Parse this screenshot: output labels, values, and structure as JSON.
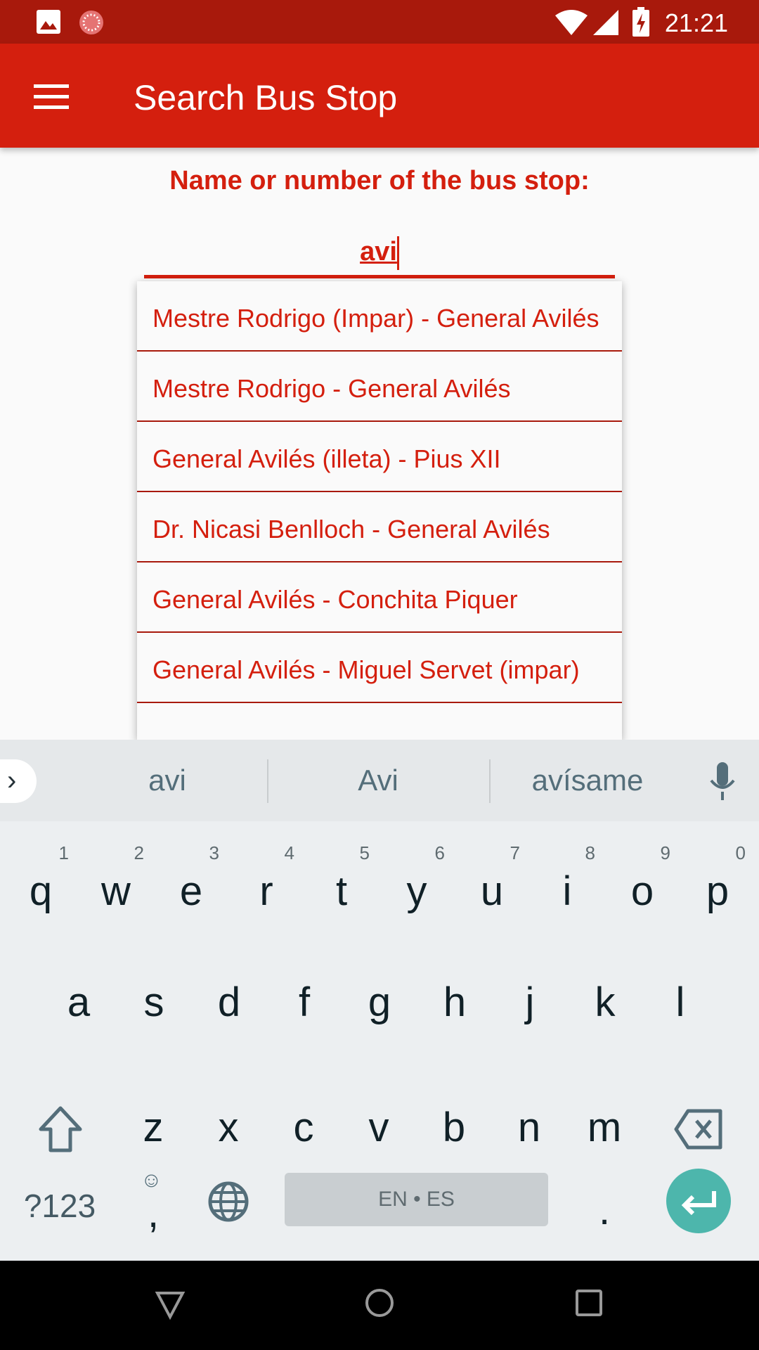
{
  "status": {
    "time": "21:21"
  },
  "appbar": {
    "title": "Search Bus Stop"
  },
  "search": {
    "label": "Name or number of the bus stop:",
    "value": "avi"
  },
  "suggestions": [
    "Mestre Rodrigo (Impar) - General Avilés",
    "Mestre Rodrigo - General Avilés",
    "General Avilés (illeta) - Pius XII",
    "Dr. Nicasi Benlloch - General Avilés",
    "General Avilés - Conchita Piquer",
    "General Avilés - Miguel Servet (impar)"
  ],
  "keyboard": {
    "word_suggestions": [
      "avi",
      "Avi",
      "avísame"
    ],
    "row1": [
      "q",
      "w",
      "e",
      "r",
      "t",
      "y",
      "u",
      "i",
      "o",
      "p"
    ],
    "row1_nums": [
      "1",
      "2",
      "3",
      "4",
      "5",
      "6",
      "7",
      "8",
      "9",
      "0"
    ],
    "row2": [
      "a",
      "s",
      "d",
      "f",
      "g",
      "h",
      "j",
      "k",
      "l"
    ],
    "row3": [
      "z",
      "x",
      "c",
      "v",
      "b",
      "n",
      "m"
    ],
    "symbols": "?123",
    "comma": ",",
    "space": "EN • ES",
    "period": "."
  },
  "colors": {
    "primary": "#d41f0e",
    "status": "#a8190c",
    "enter": "#4db6ac"
  }
}
